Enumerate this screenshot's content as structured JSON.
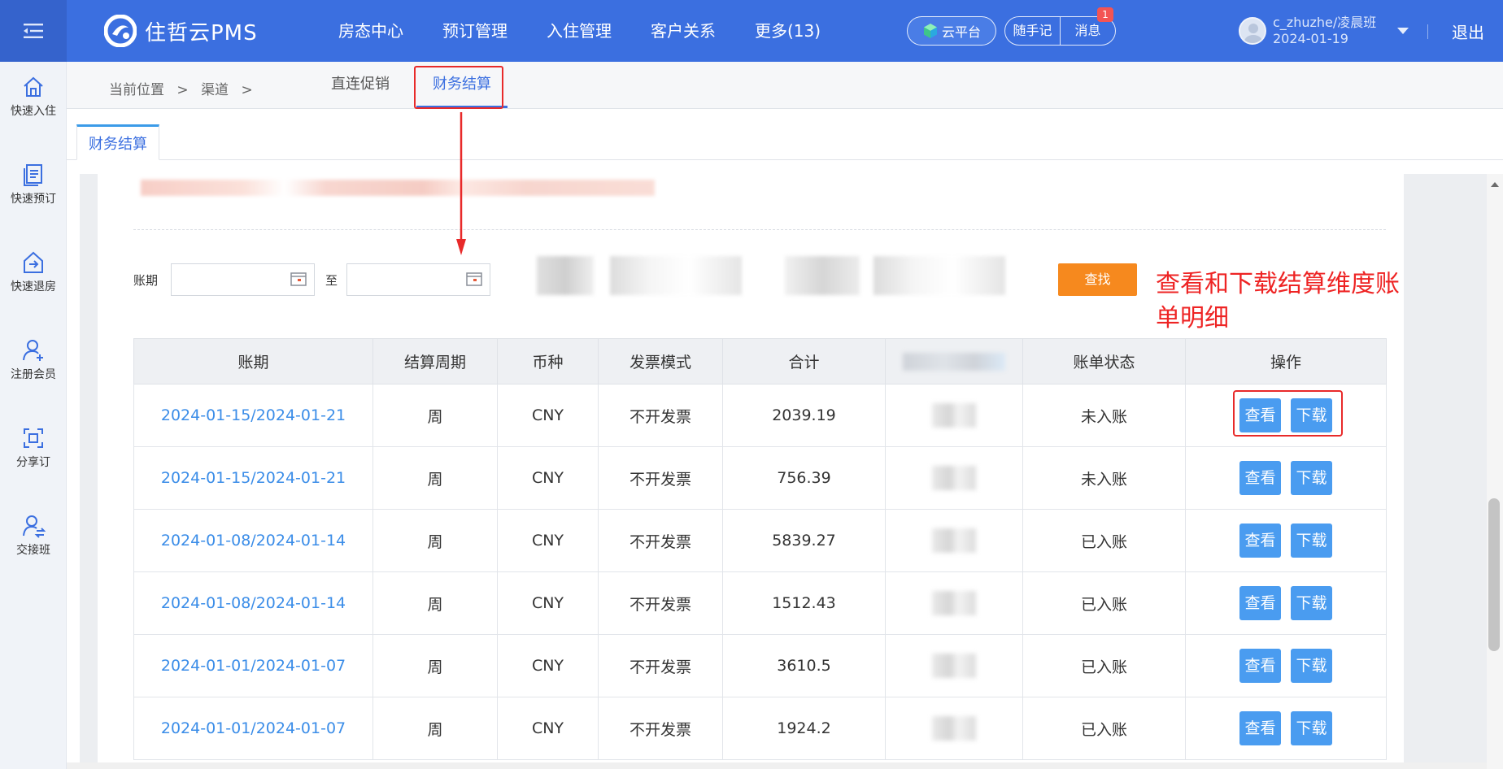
{
  "header": {
    "brand": "住哲云PMS",
    "nav": [
      "房态中心",
      "预订管理",
      "入住管理",
      "客户关系",
      "更多(13)"
    ],
    "cloud": "云平台",
    "notes": "随手记",
    "messages": "消息",
    "message_badge": "1",
    "user_name": "c_zhuzhe/凌晨班",
    "user_date": "2024-01-19",
    "logout": "退出"
  },
  "sidebar": [
    {
      "label": "快速入住",
      "icon": "home-icon"
    },
    {
      "label": "快速预订",
      "icon": "booking-icon"
    },
    {
      "label": "快速退房",
      "icon": "checkout-icon"
    },
    {
      "label": "注册会员",
      "icon": "add-member-icon"
    },
    {
      "label": "分享订",
      "icon": "share-icon"
    },
    {
      "label": "交接班",
      "icon": "handover-icon"
    }
  ],
  "breadcrumb": {
    "current": "当前位置",
    "sep": ">",
    "channel": "渠道",
    "sep2": ">"
  },
  "subtabs": [
    "直连促销",
    "财务结算"
  ],
  "page_tab": "财务结算",
  "filter": {
    "period_label": "账期",
    "to_label": "至",
    "start_value": "",
    "end_value": "",
    "search": "查找"
  },
  "annotation": "查看和下载结算维度账单明细",
  "table": {
    "headers": [
      "账期",
      "结算周期",
      "币种",
      "发票模式",
      "合计",
      "",
      "账单状态",
      "操作"
    ],
    "view_label": "查看",
    "download_label": "下载",
    "rows": [
      {
        "period": "2024-01-15/2024-01-21",
        "cycle": "周",
        "currency": "CNY",
        "invoice": "不开发票",
        "total": "2039.19",
        "status": "未入账"
      },
      {
        "period": "2024-01-15/2024-01-21",
        "cycle": "周",
        "currency": "CNY",
        "invoice": "不开发票",
        "total": "756.39",
        "status": "未入账"
      },
      {
        "period": "2024-01-08/2024-01-14",
        "cycle": "周",
        "currency": "CNY",
        "invoice": "不开发票",
        "total": "5839.27",
        "status": "已入账"
      },
      {
        "period": "2024-01-08/2024-01-14",
        "cycle": "周",
        "currency": "CNY",
        "invoice": "不开发票",
        "total": "1512.43",
        "status": "已入账"
      },
      {
        "period": "2024-01-01/2024-01-07",
        "cycle": "周",
        "currency": "CNY",
        "invoice": "不开发票",
        "total": "3610.5",
        "status": "已入账"
      },
      {
        "period": "2024-01-01/2024-01-07",
        "cycle": "周",
        "currency": "CNY",
        "invoice": "不开发票",
        "total": "1924.2",
        "status": "已入账"
      }
    ]
  },
  "colors": {
    "primary": "#3b6fe0",
    "link": "#3b8de8",
    "button": "#4a9cf0",
    "search": "#f6891e",
    "annotation": "#ee2424"
  }
}
